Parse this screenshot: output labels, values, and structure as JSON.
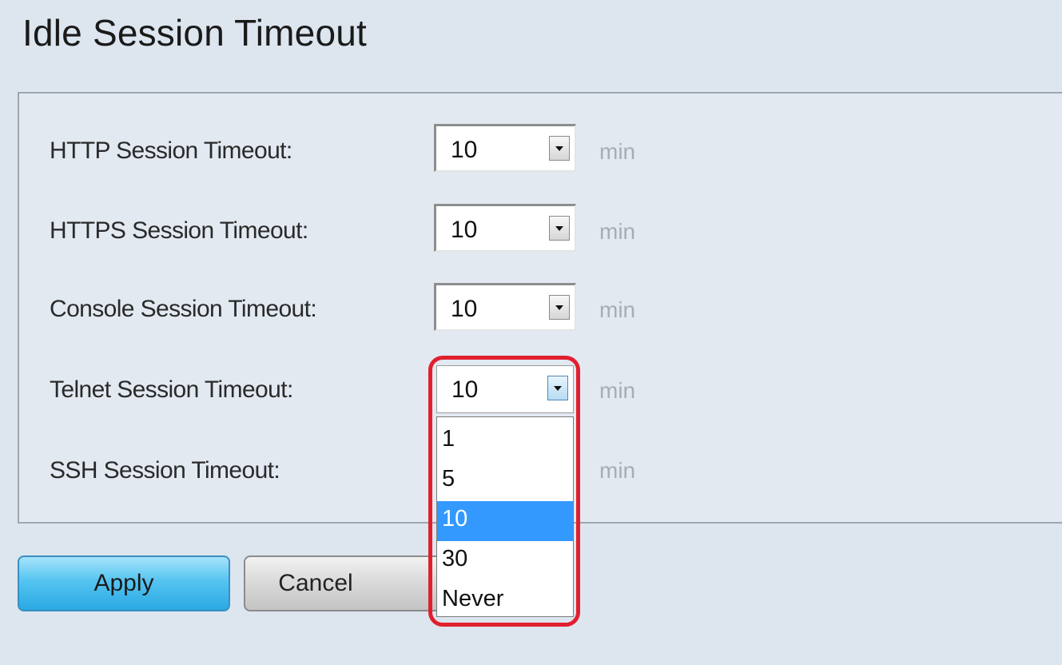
{
  "page": {
    "title": "Idle Session Timeout"
  },
  "rows": [
    {
      "label": "HTTP Session Timeout:",
      "value": "10",
      "unit": "min"
    },
    {
      "label": "HTTPS Session Timeout:",
      "value": "10",
      "unit": "min"
    },
    {
      "label": "Console Session Timeout:",
      "value": "10",
      "unit": "min"
    },
    {
      "label": "Telnet Session Timeout:",
      "value": "10",
      "unit": "min"
    },
    {
      "label": "SSH Session Timeout:",
      "unit": "min"
    }
  ],
  "dropdown": {
    "options": [
      "1",
      "5",
      "10",
      "30",
      "Never"
    ],
    "selected": "10"
  },
  "buttons": {
    "apply": "Apply",
    "cancel": "Cancel"
  },
  "colors": {
    "highlight": "#e0202e",
    "selected_option": "#3399ff",
    "apply_button": "#54c4f1"
  }
}
